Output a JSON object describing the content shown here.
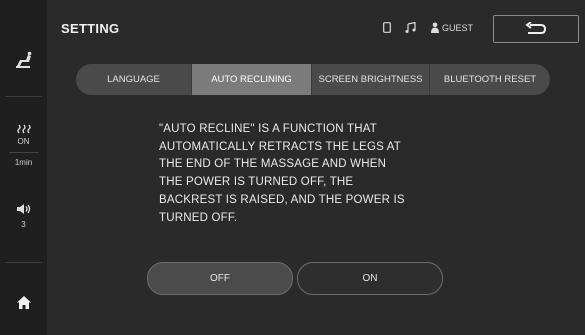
{
  "header": {
    "title": "SETTING",
    "guest_label": "GUEST"
  },
  "icons": {
    "sidebar_top": "recline-chair-icon",
    "heat": "heat-icon",
    "volume": "volume-icon",
    "home": "home-icon",
    "tablet": "tablet-icon",
    "music": "music-icon",
    "user": "user-icon",
    "back": "back-arrow-icon"
  },
  "sidebar": {
    "heat_status": "ON",
    "heat_time": "1min",
    "volume_level": "3"
  },
  "tabs": [
    {
      "label": "LANGUAGE",
      "active": false
    },
    {
      "label": "AUTO RECLINING",
      "active": true
    },
    {
      "label": "SCREEN BRIGHTNESS",
      "active": false
    },
    {
      "label": "BLUETOOTH RESET",
      "active": false
    }
  ],
  "description": {
    "lines": [
      "\"AUTO RECLINE\" IS A FUNCTION THAT",
      "AUTOMATICALLY RETRACTS THE LEGS AT",
      "THE END OF THE MASSAGE AND WHEN",
      "THE POWER IS TURNED OFF, THE",
      "BACKREST IS RAISED, AND THE POWER IS",
      "TURNED OFF."
    ]
  },
  "toggle": {
    "off_label": "OFF",
    "on_label": "ON",
    "selected": "OFF"
  },
  "colors": {
    "background": "#2a2a2a",
    "sidebar": "#1f1f1f",
    "tab_bar": "#4a4a4a",
    "tab_active": "#7b7b7b",
    "text": "#eaeaea"
  }
}
